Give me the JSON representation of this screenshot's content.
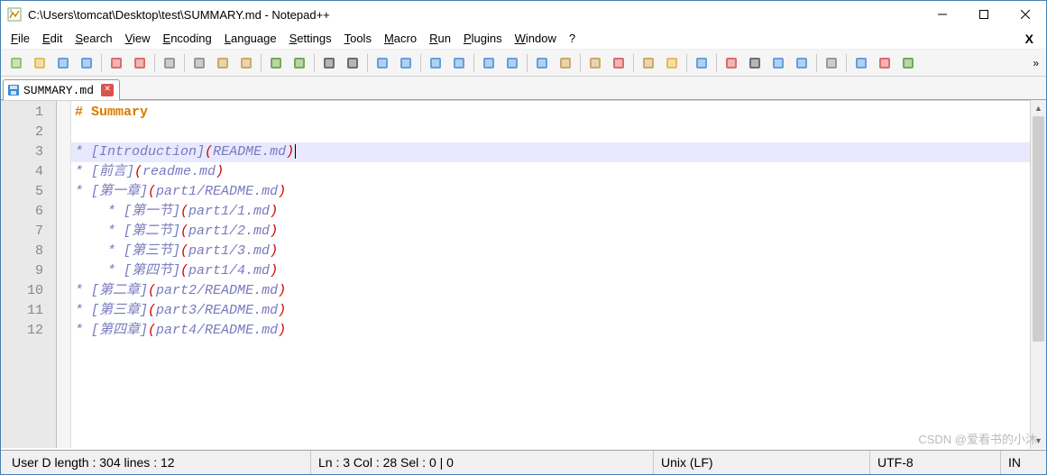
{
  "window": {
    "title": "C:\\Users\\tomcat\\Desktop\\test\\SUMMARY.md - Notepad++"
  },
  "menu": {
    "items": [
      {
        "label": "File",
        "u": "F"
      },
      {
        "label": "Edit",
        "u": "E"
      },
      {
        "label": "Search",
        "u": "S"
      },
      {
        "label": "View",
        "u": "V"
      },
      {
        "label": "Encoding",
        "u": "E"
      },
      {
        "label": "Language",
        "u": "L"
      },
      {
        "label": "Settings",
        "u": "S"
      },
      {
        "label": "Tools",
        "u": "T"
      },
      {
        "label": "Macro",
        "u": "M"
      },
      {
        "label": "Run",
        "u": "R"
      },
      {
        "label": "Plugins",
        "u": "P"
      },
      {
        "label": "Window",
        "u": "W"
      },
      {
        "label": "?",
        "u": "?"
      }
    ],
    "xlabel": "X"
  },
  "toolbar": {
    "icons": [
      "new-file",
      "open-file",
      "save",
      "save-all",
      "sep",
      "close-file",
      "close-all",
      "sep",
      "print",
      "sep",
      "cut",
      "copy",
      "paste",
      "sep",
      "undo",
      "redo",
      "sep",
      "find",
      "replace",
      "sep",
      "zoom-in",
      "zoom-out",
      "sep",
      "sync-v",
      "sync-h",
      "sep",
      "wrap",
      "all-chars",
      "sep",
      "indent-guide",
      "lang",
      "sep",
      "doc-map",
      "doc-list",
      "sep",
      "function-list",
      "folder",
      "sep",
      "monitor",
      "sep",
      "record",
      "stop",
      "play",
      "play-multi",
      "sep",
      "save-macro",
      "sep",
      "spell1",
      "spell2",
      "spell3"
    ],
    "overflow": "»"
  },
  "tab": {
    "label": "SUMMARY.md"
  },
  "editor": {
    "lines": [
      {
        "n": "1",
        "type": "h1",
        "hash": "#",
        "text": "Summary"
      },
      {
        "n": "2",
        "type": "blank",
        "text": ""
      },
      {
        "n": "3",
        "type": "li",
        "indent": 0,
        "hl": true,
        "caret": true,
        "label": "Introduction",
        "path": "README.md"
      },
      {
        "n": "4",
        "type": "li",
        "indent": 0,
        "label": "前言",
        "path": "readme.md"
      },
      {
        "n": "5",
        "type": "li",
        "indent": 0,
        "label": "第一章",
        "path": "part1/README.md"
      },
      {
        "n": "6",
        "type": "li",
        "indent": 1,
        "label": "第一节",
        "path": "part1/1.md"
      },
      {
        "n": "7",
        "type": "li",
        "indent": 1,
        "label": "第二节",
        "path": "part1/2.md"
      },
      {
        "n": "8",
        "type": "li",
        "indent": 1,
        "label": "第三节",
        "path": "part1/3.md"
      },
      {
        "n": "9",
        "type": "li",
        "indent": 1,
        "label": "第四节",
        "path": "part1/4.md"
      },
      {
        "n": "10",
        "type": "li",
        "indent": 0,
        "label": "第二章",
        "path": "part2/README.md"
      },
      {
        "n": "11",
        "type": "li",
        "indent": 0,
        "label": "第三章",
        "path": "part3/README.md"
      },
      {
        "n": "12",
        "type": "li",
        "indent": 0,
        "label": "第四章",
        "path": "part4/README.md"
      }
    ]
  },
  "status": {
    "left": "User D length : 304    lines : 12",
    "pos": "Ln : 3    Col : 28    Sel : 0 | 0",
    "eol": "Unix (LF)",
    "enc": "UTF-8",
    "ins": "IN"
  },
  "watermark": "CSDN @爱看书的小沐"
}
